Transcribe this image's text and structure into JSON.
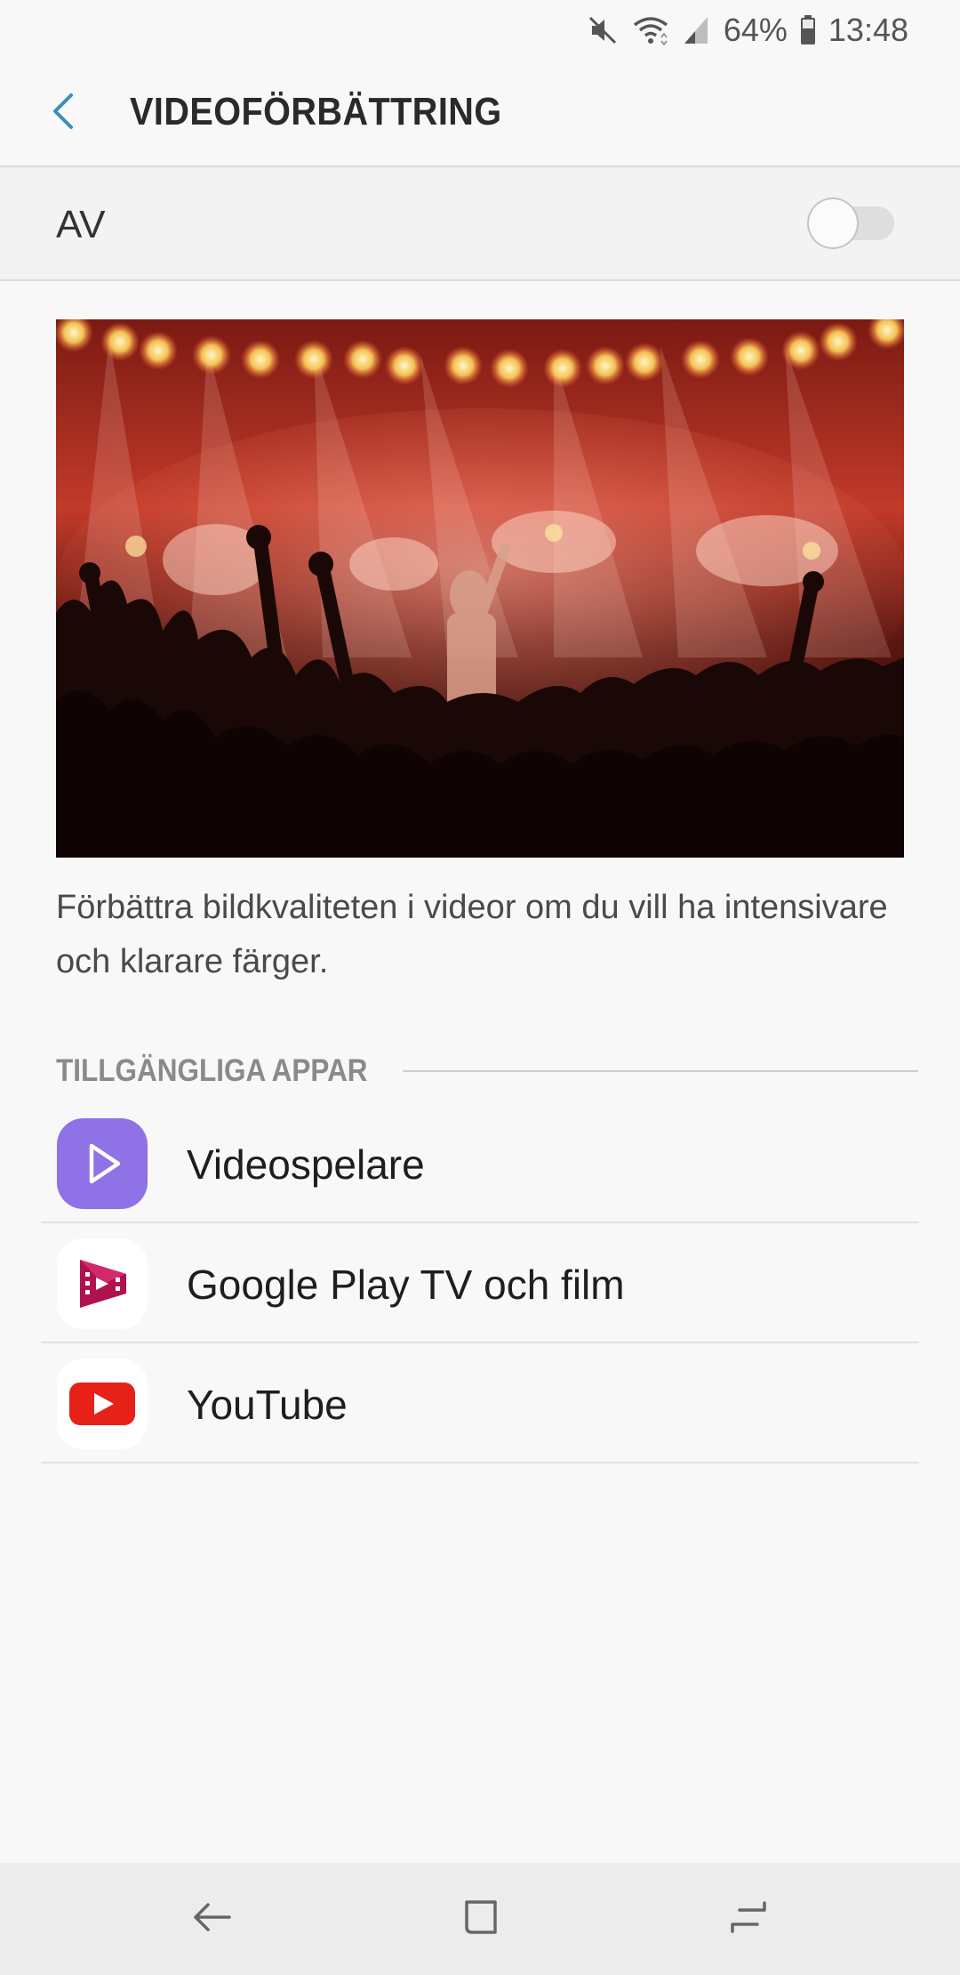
{
  "status_bar": {
    "battery_percent": "64%",
    "time": "13:48",
    "icons": [
      "mute-icon",
      "wifi-icon",
      "signal-icon",
      "battery-icon"
    ]
  },
  "header": {
    "title": "VIDEOFÖRBÄTTRING",
    "back_icon": "chevron-left-icon"
  },
  "master_switch": {
    "label": "AV",
    "state": "off"
  },
  "hero": {
    "description": "Concert crowd illustration"
  },
  "description": "Förbättra bildkvaliteten i videor om du vill ha intensivare och klarare färger.",
  "section": {
    "title": "TILLGÄNGLIGA APPAR"
  },
  "apps": [
    {
      "name": "Videospelare",
      "icon": "video-player-icon"
    },
    {
      "name": "Google Play TV och film",
      "icon": "google-play-movies-icon"
    },
    {
      "name": "YouTube",
      "icon": "youtube-icon"
    }
  ],
  "navbar": {
    "buttons": [
      "back-icon",
      "home-icon",
      "recents-icon"
    ]
  },
  "colors": {
    "accent": "#3e8dbd",
    "videospelare": "#8e72e6",
    "youtube_red": "#e62117",
    "gplay_red": "#b0124f"
  }
}
